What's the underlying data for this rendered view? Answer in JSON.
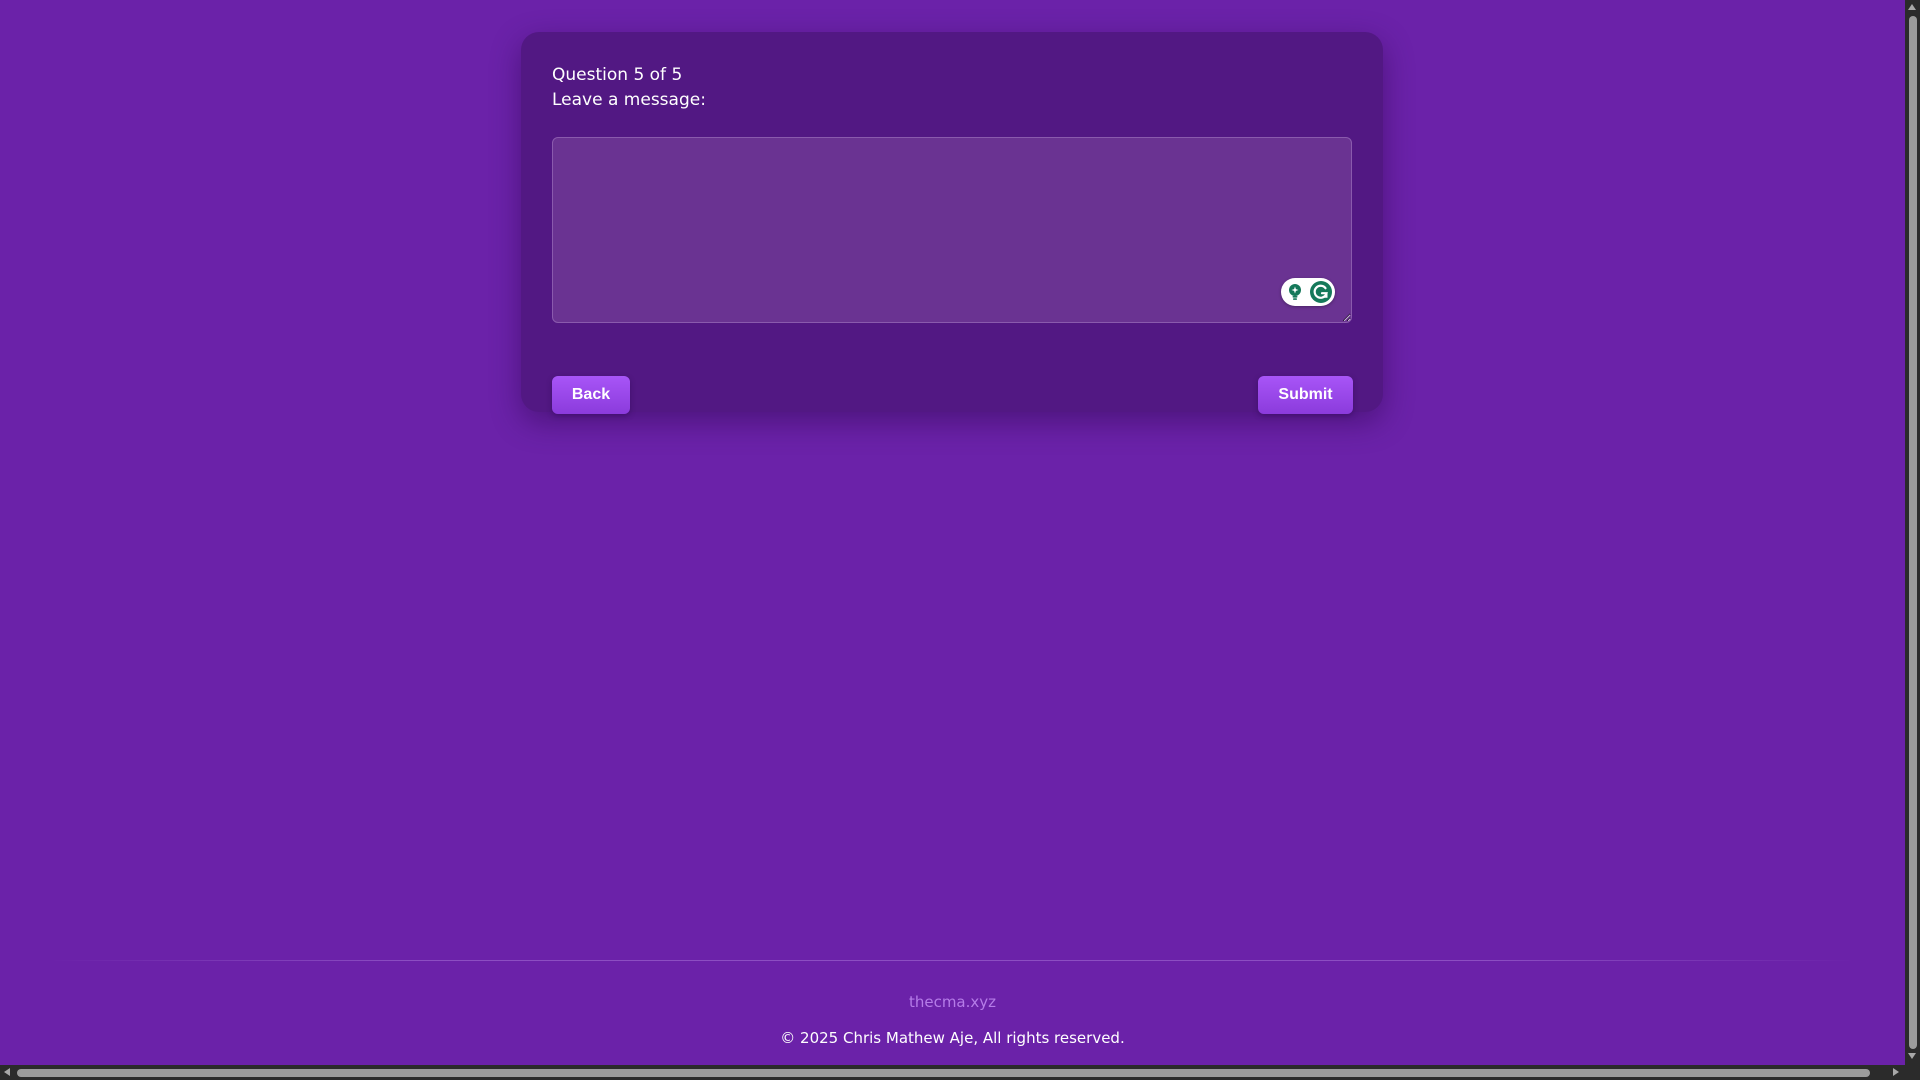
{
  "form": {
    "progress": "Question 5 of 5",
    "question": "Leave a message:",
    "message_value": "",
    "back_label": "Back",
    "submit_label": "Submit"
  },
  "footer": {
    "link_text": "thecma.xyz",
    "copyright": "© 2025 Chris Mathew Aje, All rights reserved."
  },
  "extension": {
    "icons": [
      "lightbulb-icon",
      "grammarly-icon"
    ]
  },
  "colors": {
    "background": "#6b22a9",
    "card": "#521883",
    "button": "#a855f7",
    "link": "#b57ce8"
  }
}
